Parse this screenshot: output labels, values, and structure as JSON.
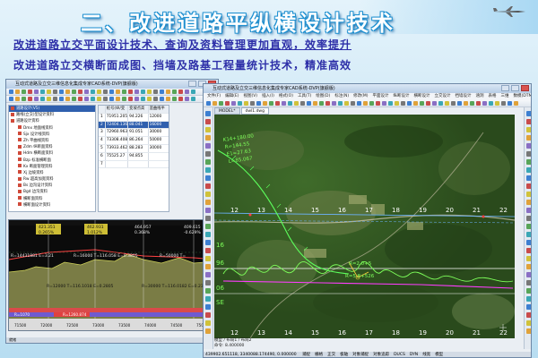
{
  "slide": {
    "title": "二、改进道路平纵横设计技术",
    "line1": "改进道路立交平面设计技术、查询及资料管理更加直观，效率提升",
    "line2": "改进道路立交横断面成图、挡墙及路基工程量统计技术，精准高效"
  },
  "left_window": {
    "title": "互动式道路及立交三维信息化集成专家CAD系统-DVP(旗舰版)",
    "tree_items": [
      "道路设计(V5)",
      "路线(立交)型设计资料",
      "道路设计资料",
      "Dmx 地面线资料",
      "Sjx 设计线资料",
      "Zh 平曲线资料",
      "Zdm 纵断面资料",
      "Hdm 横断面资料",
      "Bzp 标准横断面",
      "Kx 断面管理资料",
      "Xj 边坡资料",
      "Rw 超高加宽资料",
      "Bs 边沟设计资料",
      "Bgd 边沟资料",
      "横断面资料",
      "横断面设计资料"
    ],
    "grid_headers": [
      "",
      "桩号(纵/变坡)",
      "变坡点高程",
      "竖曲线半径"
    ],
    "grid_rows": [
      [
        "1",
        "71951.205",
        "94.226",
        "12000"
      ],
      [
        "2",
        "72404.136",
        "88.041",
        "16000"
      ],
      [
        "3",
        "72960.963",
        "91.051",
        "30000"
      ],
      [
        "4",
        "73308.408",
        "86.264",
        "50000"
      ],
      [
        "5",
        "73933.462",
        "88.283",
        "30000"
      ],
      [
        "6",
        "75525.27",
        "94.855",
        ""
      ],
      [
        "7",
        "",
        "",
        ""
      ]
    ],
    "selected_row": 1,
    "graph_labels": {
      "elev_top": [
        "421.351",
        "462.931",
        "464.957",
        "409.615"
      ],
      "grades": [
        "0.265%",
        "1.012%",
        "0.368%",
        "-0.629%"
      ],
      "pvi1": "R=14431881 E=3.21",
      "pvi2": "R=16000 T=116.058 E=0.3805",
      "pvi3": "R=50000 T=",
      "pvi4": "R=12000 T=116.1018 E=0.2805",
      "pvi5": "R=30000 T=116.0182 E=0.2381",
      "bottom1": "R=1070",
      "bottom2": "R=1260.874",
      "stations": [
        "71500",
        "72000",
        "72500",
        "73000",
        "73500",
        "74000",
        "74500",
        "75000"
      ]
    },
    "status": "就绪"
  },
  "right_window": {
    "title": "互动式道路及立交三维信息化集成专家CAD系统-DVP(旗舰版)",
    "menus": [
      "文件(F)",
      "编辑(E)",
      "视图(V)",
      "插入(I)",
      "格式(O)",
      "工具(T)",
      "绘图(D)",
      "标注(N)",
      "修改(M)",
      "平面设计",
      "纵断设计",
      "横断设计",
      "立交设计",
      "挡墙设计",
      "涵洞",
      "表格",
      "三维",
      "数模(DTM)",
      "图库",
      "打印",
      "窗口(W)",
      "帮助(H)"
    ],
    "layer": "ByLayer",
    "doc_tabs": [
      "MODEL*",
      "dwl1.dwg"
    ],
    "layout_tabs": "模型 / 布局1 / 布局2",
    "coord_cmd": "命令: 8.400000",
    "status_coords": "439902.651118, 3340088.174490, 0.000000",
    "status_items": [
      "捕捉",
      "栅格",
      "正交",
      "极轴",
      "对象捕捉",
      "对象追踪",
      "DUCS",
      "DYN",
      "线宽",
      "模型"
    ],
    "overlay": {
      "station_labels": [
        "12",
        "13",
        "14",
        "15",
        "16",
        "17",
        "18",
        "19",
        "20",
        "21",
        "22"
      ],
      "profile_labels": [
        "16",
        "96",
        "06",
        "SE"
      ],
      "callouts": [
        "K14+180.00",
        "R=144.55",
        "E1=27.63",
        "L=85.067"
      ],
      "mid_label1": "R=2.0+5",
      "mid_label2": "R=5.8+526"
    }
  }
}
